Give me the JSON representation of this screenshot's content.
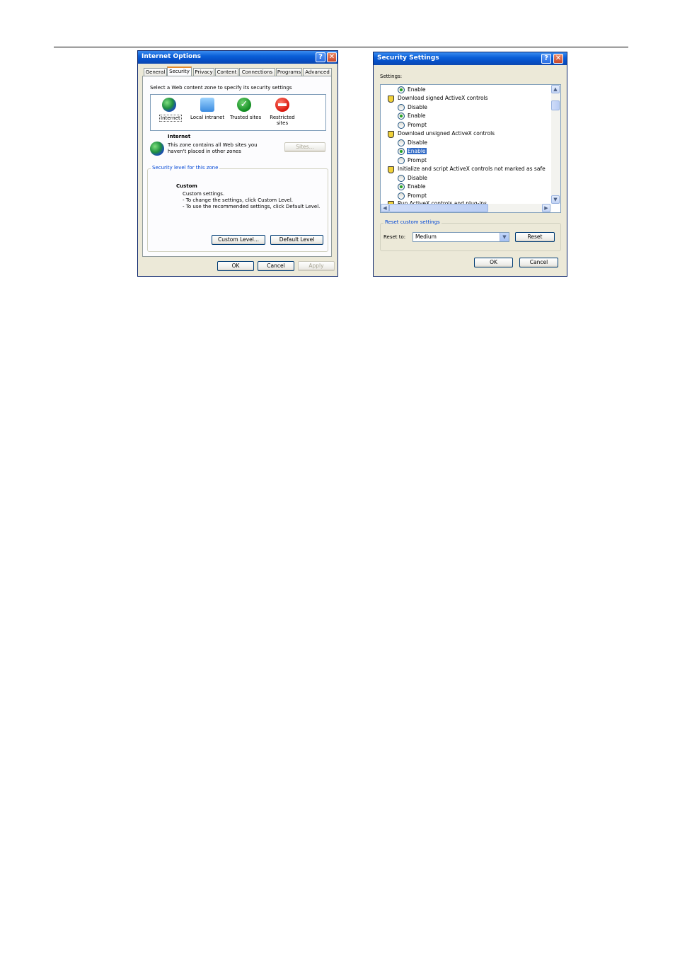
{
  "internet_options": {
    "title": "Internet Options",
    "tabs": [
      "General",
      "Security",
      "Privacy",
      "Content",
      "Connections",
      "Programs",
      "Advanced"
    ],
    "active_tab": "Security",
    "zone_prompt": "Select a Web content zone to specify its security settings",
    "zones": [
      {
        "label": "Internet",
        "icon": "globe-icon"
      },
      {
        "label": "Local intranet",
        "icon": "computer-icon"
      },
      {
        "label": "Trusted sites",
        "icon": "check-icon"
      },
      {
        "label": "Restricted sites",
        "icon": "no-entry-icon"
      }
    ],
    "zone_name": "Internet",
    "zone_desc_1": "This zone contains all Web sites you",
    "zone_desc_2": "haven't placed in other zones",
    "sites_button": "Sites...",
    "security_level_group": "Security level for this zone",
    "level_name": "Custom",
    "level_desc_1": "Custom settings.",
    "level_desc_2": "- To change the settings, click Custom Level.",
    "level_desc_3": "- To use the recommended settings, click Default Level.",
    "custom_level_button": "Custom Level...",
    "default_level_button": "Default Level",
    "ok": "OK",
    "cancel": "Cancel",
    "apply": "Apply"
  },
  "security_settings": {
    "title": "Security Settings",
    "settings_label": "Settings:",
    "items": [
      {
        "type": "option",
        "label": "Enable",
        "checked": true
      },
      {
        "type": "category",
        "label": "Download signed ActiveX controls"
      },
      {
        "type": "option",
        "label": "Disable",
        "checked": false
      },
      {
        "type": "option",
        "label": "Enable",
        "checked": true
      },
      {
        "type": "option",
        "label": "Prompt",
        "checked": false
      },
      {
        "type": "category",
        "label": "Download unsigned ActiveX controls"
      },
      {
        "type": "option",
        "label": "Disable",
        "checked": false
      },
      {
        "type": "option",
        "label": "Enable",
        "checked": true,
        "selected": true
      },
      {
        "type": "option",
        "label": "Prompt",
        "checked": false
      },
      {
        "type": "category",
        "label": "Initialize and script ActiveX controls not marked as safe"
      },
      {
        "type": "option",
        "label": "Disable",
        "checked": false
      },
      {
        "type": "option",
        "label": "Enable",
        "checked": true
      },
      {
        "type": "option",
        "label": "Prompt",
        "checked": false
      },
      {
        "type": "category",
        "label": "Run ActiveX controls and plug-ins"
      }
    ],
    "reset_group": "Reset custom settings",
    "reset_to_label": "Reset to:",
    "reset_to_value": "Medium",
    "reset_button": "Reset",
    "ok": "OK",
    "cancel": "Cancel"
  }
}
